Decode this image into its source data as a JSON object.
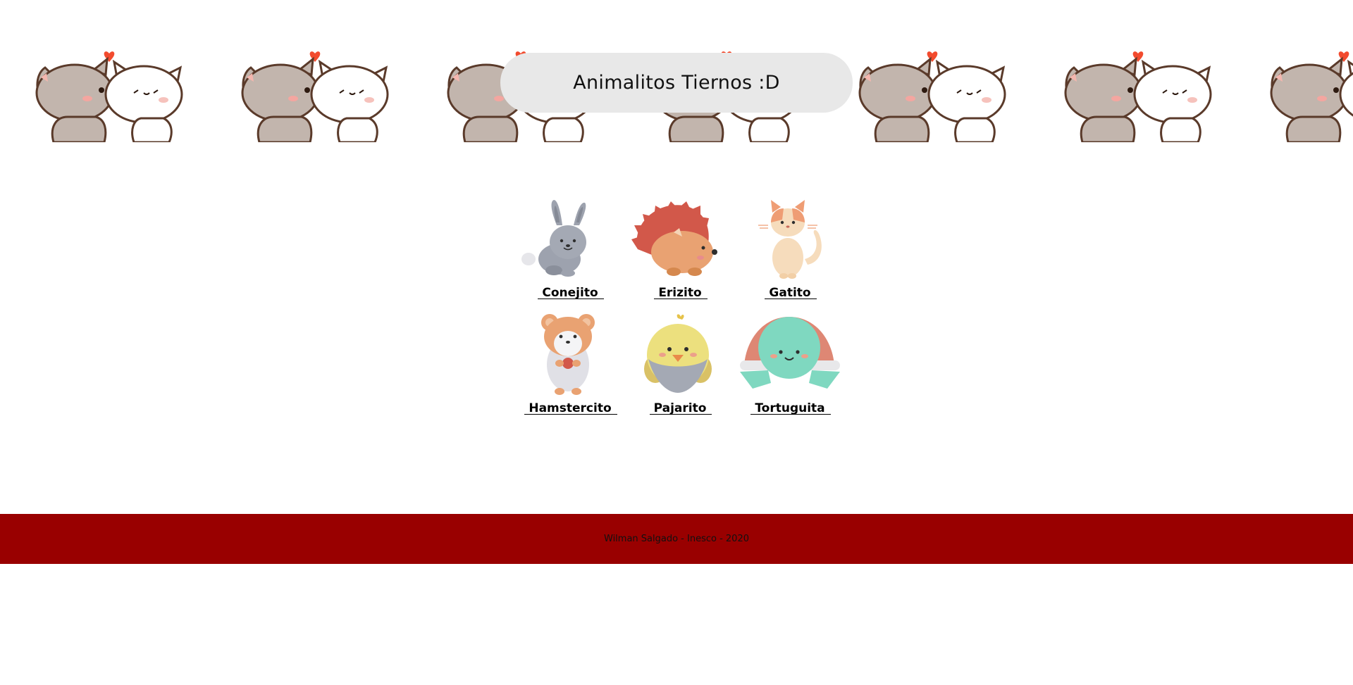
{
  "page": {
    "title": "Animalitos Tiernos :D",
    "banner_icon": "kissing-cats-illustration"
  },
  "animals": [
    {
      "name": "Conejito",
      "icon": "rabbit-icon"
    },
    {
      "name": "Erizito",
      "icon": "hedgehog-icon"
    },
    {
      "name": "Gatito",
      "icon": "cat-icon"
    },
    {
      "name": "Hamstercito",
      "icon": "hamster-icon"
    },
    {
      "name": "Pajarito",
      "icon": "bird-icon"
    },
    {
      "name": "Tortuguita",
      "icon": "turtle-icon"
    }
  ],
  "footer": {
    "text": "Wilman Salgado - Inesco - 2020",
    "color": "#990000"
  },
  "colors": {
    "title_pill": "#e8e8e8",
    "heart": "#f24b2e",
    "footer_bg": "#990000"
  }
}
